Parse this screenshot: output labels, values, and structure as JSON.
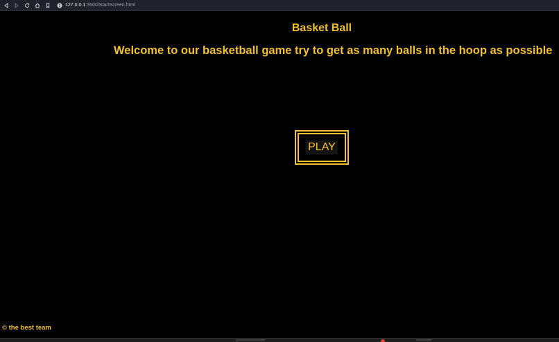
{
  "browser": {
    "url_host": "127.0.0.1",
    "url_rest": ":5500/StartScreen.html",
    "icons": [
      "back-icon",
      "forward-icon",
      "reload-icon",
      "home-icon",
      "bookmark-icon",
      "info-icon"
    ]
  },
  "page": {
    "title": "Basket Ball",
    "welcome": "Welcome to our basketball game try to get as many balls in the hoop as possible",
    "play_label": "PLAY",
    "footer": "© the best team"
  },
  "colors": {
    "background": "#000000",
    "accent": "#f2c12e",
    "browser_bar": "#1f2329"
  }
}
